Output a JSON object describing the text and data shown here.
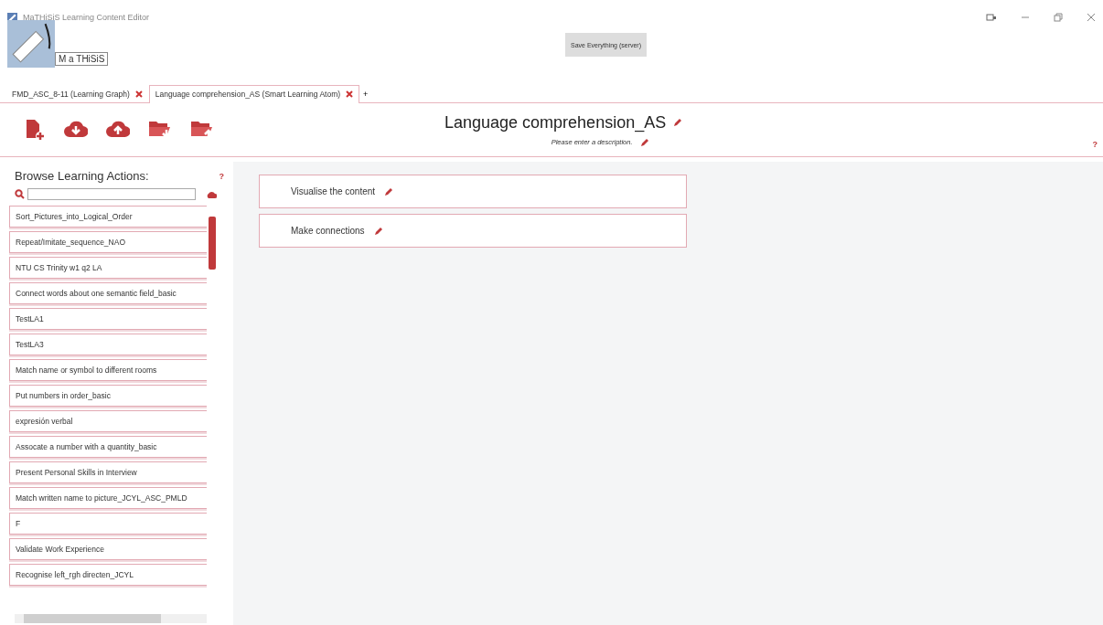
{
  "window": {
    "title": "MaTHiSiS Learning Content Editor"
  },
  "logo": {
    "text": "M a THiSiS"
  },
  "save_button": {
    "label": "Save Everything (server)"
  },
  "tabs": [
    {
      "label": "FMD_ASC_8-11 (Learning Graph)",
      "selected": false
    },
    {
      "label": "Language comprehension_AS (Smart Learning Atom)",
      "selected": true
    }
  ],
  "add_tab": "+",
  "header": {
    "title": "Language comprehension_AS",
    "description": "Please enter a description.",
    "help": "?"
  },
  "sidebar": {
    "title": "Browse Learning Actions:",
    "help": "?",
    "items": [
      "Sort_Pictures_into_Logical_Order",
      "Repeat/Imitate_sequence_NAO",
      "NTU CS Trinity w1 q2 LA",
      "Connect words about one semantic field_basic",
      "TestLA1",
      "TestLA3",
      "Match name or symbol to different rooms",
      "Put numbers in order_basic",
      "expresión verbal",
      "Assocate a number with a quantity_basic",
      "Present Personal Skills in Interview",
      "Match written name to picture_JCYL_ASC_PMLD",
      "F",
      "Validate Work Experience",
      "Recognise left_rgh directen_JCYL"
    ]
  },
  "actions": [
    {
      "label": "Visualise the content"
    },
    {
      "label": "Make connections"
    }
  ]
}
